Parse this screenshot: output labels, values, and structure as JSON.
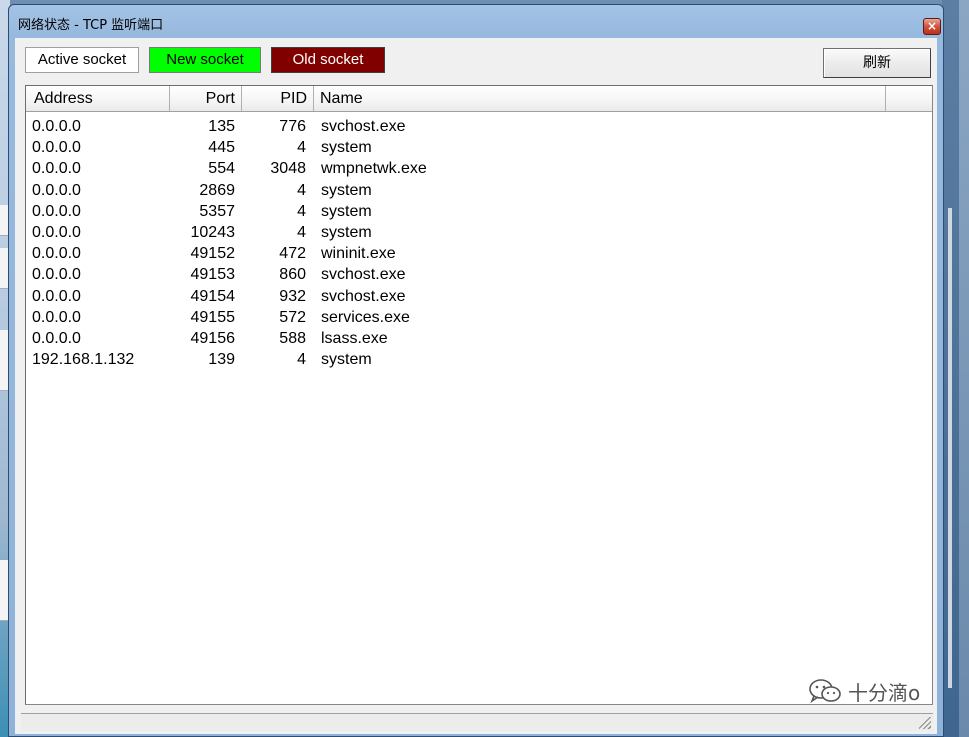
{
  "window": {
    "title": "网络状态 - TCP 监听端口",
    "close_label": "×"
  },
  "toolbar": {
    "active_socket_label": "Active socket",
    "new_socket_label": "New socket",
    "old_socket_label": "Old socket",
    "refresh_label": "刷新",
    "colors": {
      "active": "#ffffff",
      "new": "#00ff00",
      "old": "#800000"
    }
  },
  "table": {
    "columns": [
      "Address",
      "Port",
      "PID",
      "Name"
    ],
    "rows": [
      {
        "address": "0.0.0.0",
        "port": "135",
        "pid": "776",
        "name": "svchost.exe"
      },
      {
        "address": "0.0.0.0",
        "port": "445",
        "pid": "4",
        "name": "system"
      },
      {
        "address": "0.0.0.0",
        "port": "554",
        "pid": "3048",
        "name": "wmpnetwk.exe"
      },
      {
        "address": "0.0.0.0",
        "port": "2869",
        "pid": "4",
        "name": "system"
      },
      {
        "address": "0.0.0.0",
        "port": "5357",
        "pid": "4",
        "name": "system"
      },
      {
        "address": "0.0.0.0",
        "port": "10243",
        "pid": "4",
        "name": "system"
      },
      {
        "address": "0.0.0.0",
        "port": "49152",
        "pid": "472",
        "name": "wininit.exe"
      },
      {
        "address": "0.0.0.0",
        "port": "49153",
        "pid": "860",
        "name": "svchost.exe"
      },
      {
        "address": "0.0.0.0",
        "port": "49154",
        "pid": "932",
        "name": "svchost.exe"
      },
      {
        "address": "0.0.0.0",
        "port": "49155",
        "pid": "572",
        "name": "services.exe"
      },
      {
        "address": "0.0.0.0",
        "port": "49156",
        "pid": "588",
        "name": "lsass.exe"
      },
      {
        "address": "192.168.1.132",
        "port": "139",
        "pid": "4",
        "name": "system"
      }
    ]
  },
  "watermark": {
    "text": "十分滴o",
    "icon": "wechat-icon"
  }
}
